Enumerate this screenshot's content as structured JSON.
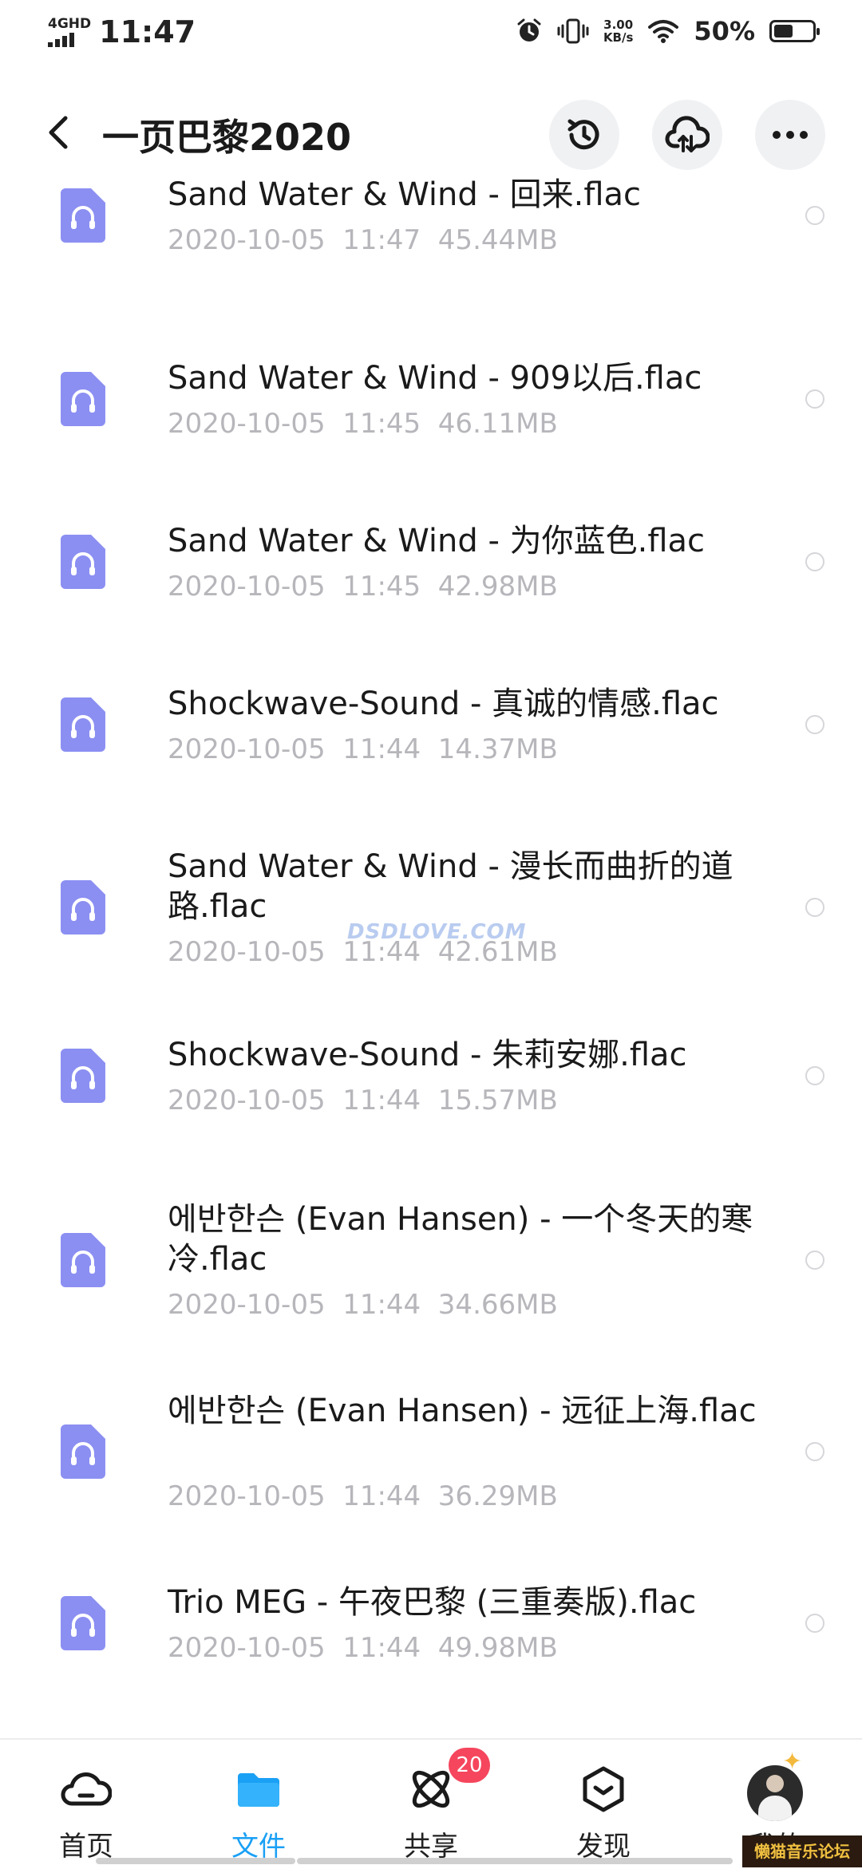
{
  "status_bar": {
    "network": "4GHD",
    "time": "11:47",
    "speed_value": "3.00",
    "speed_unit": "KB/s",
    "battery_pct": "50%",
    "battery_level": 0.5
  },
  "header": {
    "title": "一页巴黎2020",
    "icons": [
      "back-icon",
      "history-icon",
      "cloud-upload-icon",
      "more-icon"
    ]
  },
  "files": [
    {
      "name": "Sand Water & Wind - 回来.flac",
      "meta": "2020-10-05  11:47  45.44MB"
    },
    {
      "name": "Sand Water & Wind - 909以后.flac",
      "meta": "2020-10-05  11:45  46.11MB"
    },
    {
      "name": "Sand Water & Wind - 为你蓝色.flac",
      "meta": "2020-10-05  11:45  42.98MB"
    },
    {
      "name": "Shockwave-Sound - 真诚的情感.flac",
      "meta": "2020-10-05  11:44  14.37MB"
    },
    {
      "name": "Sand Water & Wind - 漫长而曲折的道路.flac",
      "meta": "2020-10-05  11:44  42.61MB"
    },
    {
      "name": "Shockwave-Sound - 朱莉安娜.flac",
      "meta": "2020-10-05  11:44  15.57MB"
    },
    {
      "name": "에반한슨 (Evan Hansen) - 一个冬天的寒冷.flac",
      "meta": "2020-10-05  11:44  34.66MB"
    },
    {
      "name": "에반한슨 (Evan Hansen) - 远征上海.flac",
      "meta": "2020-10-05  11:44  36.29MB"
    },
    {
      "name": "Trio MEG - 午夜巴黎 (三重奏版).flac",
      "meta": "2020-10-05  11:44  49.98MB"
    }
  ],
  "watermark": "DSDLOVE.COM",
  "bottom_nav": {
    "tabs": [
      {
        "label": "首页",
        "icon": "cloud-home-icon"
      },
      {
        "label": "文件",
        "icon": "folder-icon"
      },
      {
        "label": "共享",
        "icon": "atom-share-icon"
      },
      {
        "label": "发现",
        "icon": "discover-cube-icon"
      },
      {
        "label": "我的",
        "icon": "avatar"
      }
    ],
    "share_badge": "20",
    "active_color": "#1aa0f5"
  },
  "forum_stamp": "懒猫音乐论坛",
  "colors": {
    "file_icon": "#8b8ff2",
    "meta_text": "#b6b6bb",
    "badge": "#f5465d"
  }
}
